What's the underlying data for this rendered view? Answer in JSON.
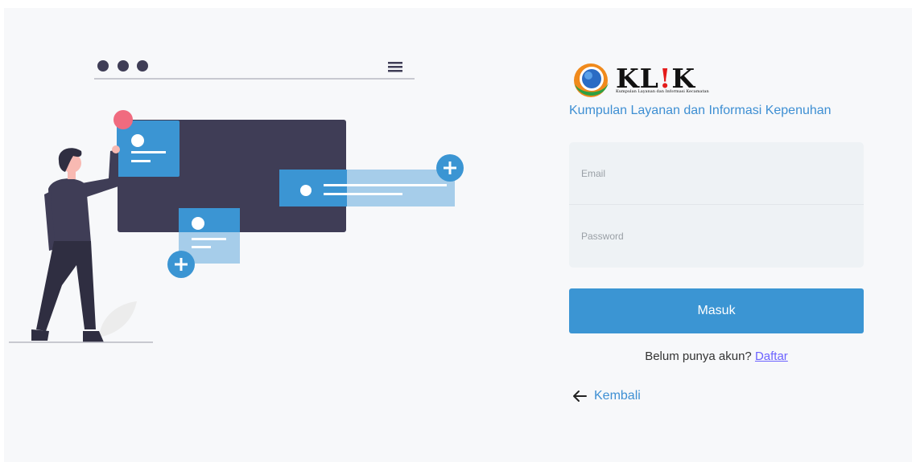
{
  "brand": {
    "logo_prefix": "KL",
    "logo_bang": "!",
    "logo_suffix": "K",
    "logo_tagline": "Kumpulan Layanan dan Informasi Kecamatan",
    "subtitle": "Kumpulan Layanan dan Informasi Kepenuhan"
  },
  "form": {
    "email_placeholder": "Email",
    "password_placeholder": "Password",
    "submit_label": "Masuk",
    "register_prompt": "Belum punya akun?",
    "register_link": "Daftar",
    "back_label": "Kembali"
  },
  "icons": {
    "back": "arrow-left-icon",
    "logo": "globe-swoosh-icon",
    "menu": "hamburger-menu-icon",
    "add": "plus-circle-icon"
  },
  "colors": {
    "accent": "#3b95d3",
    "link": "#6c63ff",
    "subtitle": "#3e8fd3",
    "illustration_dark": "#3f3d56",
    "illustration_pink": "#f06b7f"
  }
}
